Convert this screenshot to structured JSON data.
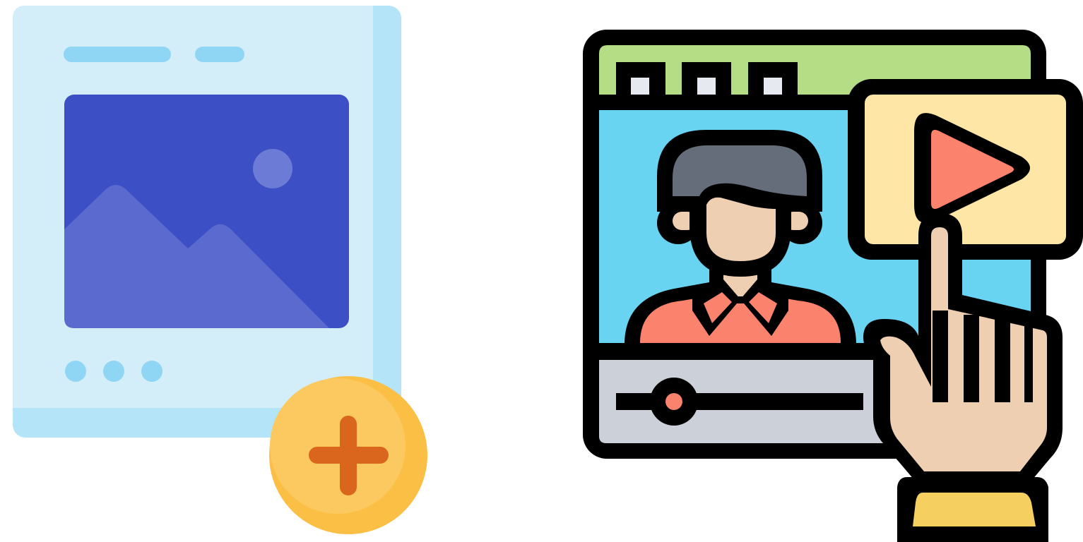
{
  "icons": [
    {
      "name": "add-image-post-icon",
      "colors": {
        "card": "#d3eef9",
        "card_edge": "#b3e4f7",
        "text_lines": "#8fd6f5",
        "image_bg": "#3c4fc4",
        "mountains": "#5b6acf",
        "sun": "#6c7bd6",
        "plus_badge": "#fbc95f",
        "plus_sign": "#d9661c"
      }
    },
    {
      "name": "video-streaming-click-icon",
      "colors": {
        "outline": "#000000",
        "header": "#b4dd85",
        "screen": "#69d3f2",
        "player_card": "#fde6a6",
        "play_button": "#fb836d",
        "hair": "#646d79",
        "skin": "#efcfb1",
        "shirt": "#fb836d",
        "control_bar": "#ccd1d9",
        "sleeve": "#f5d061"
      }
    }
  ]
}
